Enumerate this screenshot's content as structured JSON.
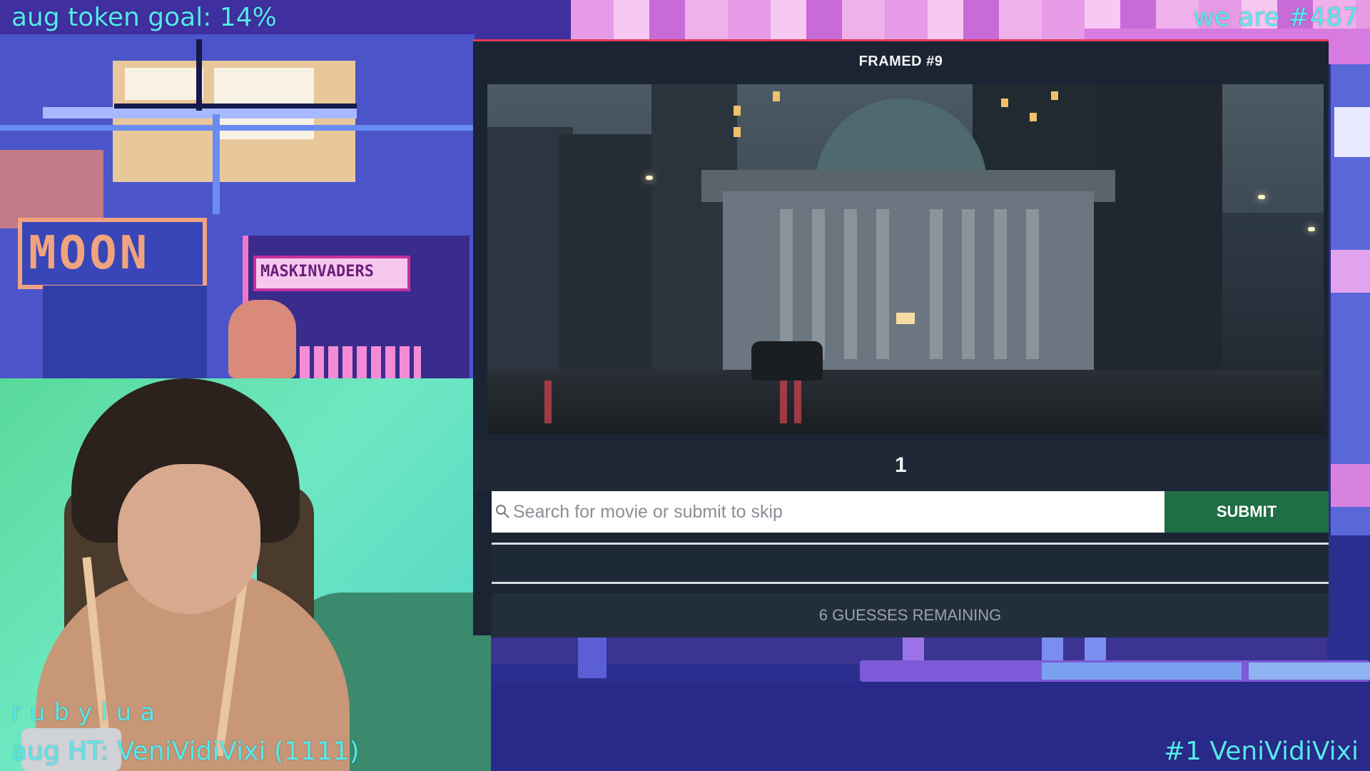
{
  "overlay": {
    "goal_text": "aug token goal: 14%",
    "rank_text": "we are #487",
    "handle_text": "rubylua",
    "high_tipper_text": "aug HT: VeniVidiVixi (1111)",
    "top_tipper_text": "#1 VeniVidiVixi",
    "accent_color": "#56e8ec"
  },
  "background": {
    "moon_sign": "MOON",
    "invaders_sign": "MASKINVADERS"
  },
  "game": {
    "title": "FRAMED #9",
    "frame_counter": "1",
    "search": {
      "placeholder": "Search for movie or submit to skip",
      "value": "",
      "icon": "search-icon"
    },
    "submit_label": "SUBMIT",
    "guesses_remaining": "6 GUESSES REMAINING",
    "colors": {
      "panel": "#1b2433",
      "submit": "#1f6e44",
      "top_border": "#e33b55"
    }
  }
}
